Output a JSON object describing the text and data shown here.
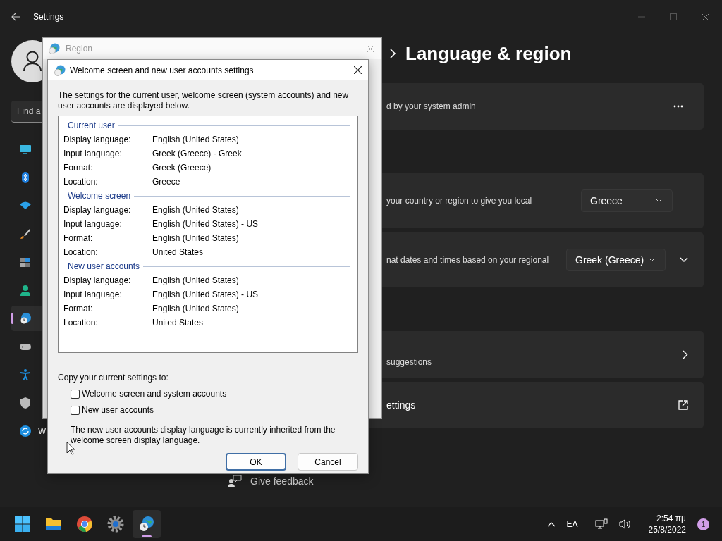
{
  "settings_window": {
    "title": "Settings",
    "search": {
      "placeholder": "Find a"
    },
    "sidebar": {
      "items": [
        {
          "kind": "display",
          "selected": false
        },
        {
          "kind": "bluetooth",
          "selected": false
        },
        {
          "kind": "wifi",
          "selected": false
        },
        {
          "kind": "brush",
          "selected": false
        },
        {
          "kind": "apps",
          "selected": false
        },
        {
          "kind": "person",
          "selected": false
        },
        {
          "kind": "time",
          "selected": true
        },
        {
          "kind": "gamepad",
          "selected": false
        },
        {
          "kind": "accessibility",
          "selected": false
        },
        {
          "kind": "shield",
          "selected": false
        },
        {
          "kind": "update",
          "selected": false,
          "label": "W"
        }
      ]
    },
    "page_title": "Language & region",
    "cards": [
      {
        "kind": "more",
        "text": "d by your system admin"
      },
      {
        "kind": "dropdown",
        "text": "your country or region to give you local",
        "value": "Greece"
      },
      {
        "kind": "dropdown_expand",
        "text": "nat dates and times based on your regional",
        "value": "Greek (Greece)"
      },
      {
        "kind": "chevron",
        "text": "suggestions"
      },
      {
        "kind": "external",
        "text": "ettings"
      }
    ],
    "feedback": "Give feedback"
  },
  "region_dialog": {
    "title": "Region"
  },
  "dialog": {
    "title": "Welcome screen and new user accounts settings",
    "intro": "The settings for the current user, welcome screen (system accounts) and new user accounts are displayed below.",
    "groups": [
      {
        "title": "Current user",
        "rows": [
          {
            "label": "Display language:",
            "value": "English (United States)"
          },
          {
            "label": "Input language:",
            "value": "Greek (Greece) - Greek"
          },
          {
            "label": "Format:",
            "value": "Greek (Greece)"
          },
          {
            "label": "Location:",
            "value": "Greece"
          }
        ]
      },
      {
        "title": "Welcome screen",
        "rows": [
          {
            "label": "Display language:",
            "value": "English (United States)"
          },
          {
            "label": "Input language:",
            "value": "English (United States) - US"
          },
          {
            "label": "Format:",
            "value": "English (United States)"
          },
          {
            "label": "Location:",
            "value": "United States"
          }
        ]
      },
      {
        "title": "New user accounts",
        "rows": [
          {
            "label": "Display language:",
            "value": "English (United States)"
          },
          {
            "label": "Input language:",
            "value": "English (United States) - US"
          },
          {
            "label": "Format:",
            "value": "English (United States)"
          },
          {
            "label": "Location:",
            "value": "United States"
          }
        ]
      }
    ],
    "copy_label": "Copy your current settings to:",
    "checkboxes": [
      {
        "label": "Welcome screen and system accounts",
        "checked": false
      },
      {
        "label": "New user accounts",
        "checked": false
      }
    ],
    "note": "The new user accounts display language is currently inherited from the welcome screen display language.",
    "buttons": [
      {
        "label": "OK",
        "default": true
      },
      {
        "label": "Cancel",
        "default": false
      }
    ]
  },
  "taskbar": {
    "apps": [
      {
        "kind": "start",
        "selected": false
      },
      {
        "kind": "explorer",
        "selected": false
      },
      {
        "kind": "browser",
        "selected": false
      },
      {
        "kind": "settings",
        "selected": false
      },
      {
        "kind": "region",
        "selected": true
      }
    ],
    "language": "ΕΛ",
    "time": "2:54 πμ",
    "date": "25/8/2022",
    "notifications": "1"
  }
}
